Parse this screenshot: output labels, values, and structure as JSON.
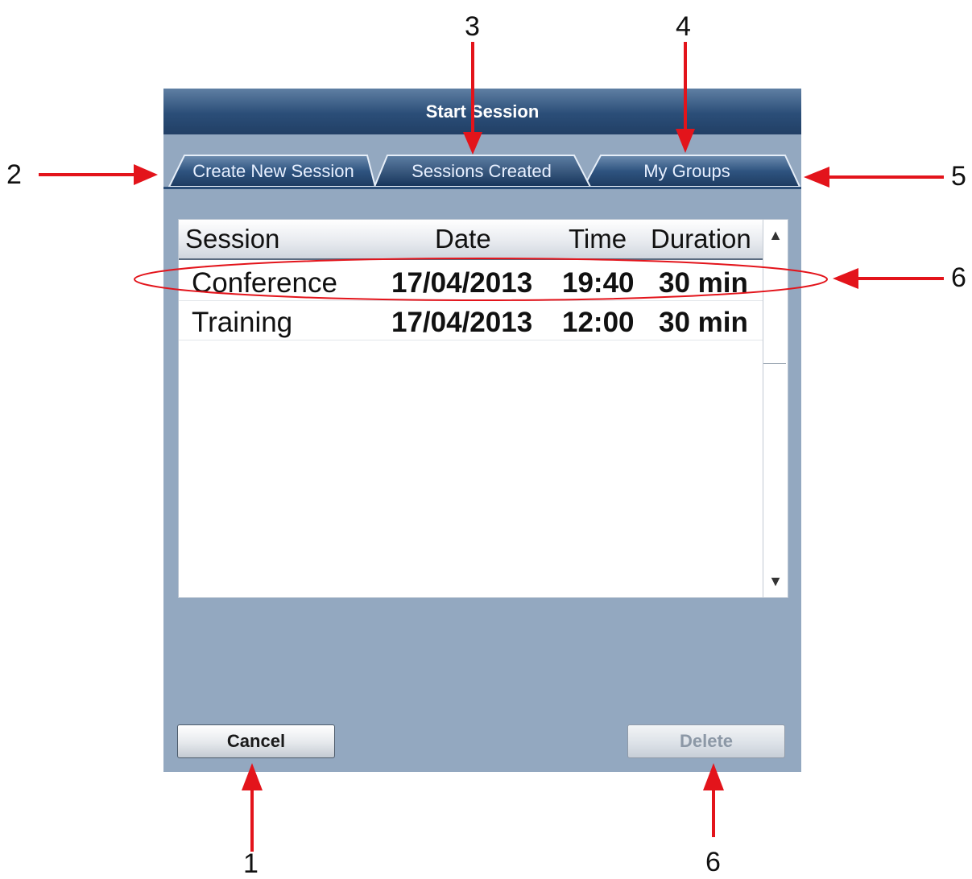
{
  "dialog": {
    "title": "Start Session",
    "tabs": [
      {
        "label": "Create New Session",
        "active": false
      },
      {
        "label": "Sessions Created",
        "active": true
      },
      {
        "label": "My Groups",
        "active": false
      }
    ],
    "table": {
      "columns": [
        "Session",
        "Date",
        "Time",
        "Duration"
      ],
      "rows": [
        {
          "session": "Conference",
          "date": "17/04/2013",
          "time": "19:40",
          "duration": "30 min"
        },
        {
          "session": "Training",
          "date": "17/04/2013",
          "time": "12:00",
          "duration": "30 min"
        }
      ]
    },
    "scroll_up": "▲",
    "scroll_down": "▼",
    "buttons": {
      "cancel": "Cancel",
      "delete": "Delete"
    }
  },
  "callouts": {
    "n1": "1",
    "n2": "2",
    "n3": "3",
    "n4": "4",
    "n5": "5",
    "n6_right": "6",
    "n6_bottom": "6"
  },
  "colors": {
    "annotation": "#e3141b",
    "titlebar": "#2b4e78",
    "dialog_bg": "#93a8c0"
  }
}
